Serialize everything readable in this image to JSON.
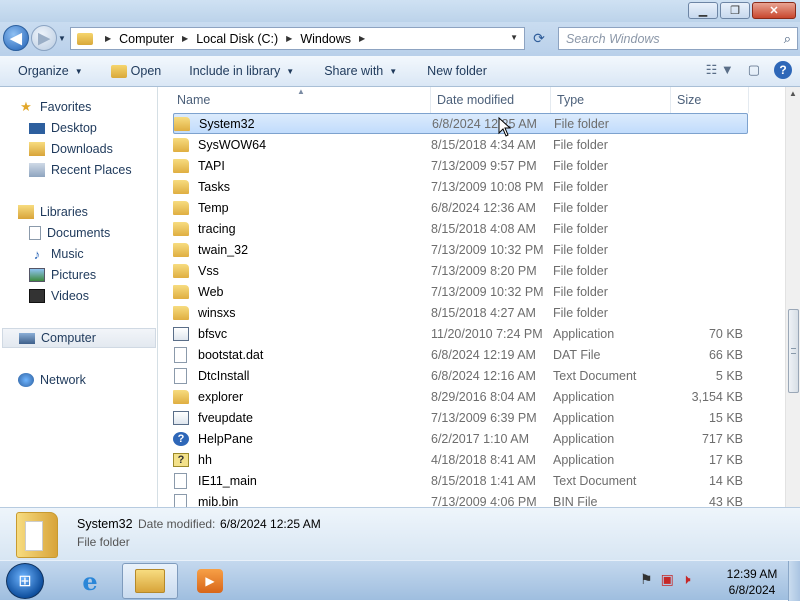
{
  "window": {
    "minimize": "▁",
    "maximize": "❐",
    "close": "✕"
  },
  "address": {
    "crumbs": [
      "Computer",
      "Local Disk (C:)",
      "Windows"
    ],
    "search_placeholder": "Search Windows"
  },
  "toolbar": {
    "organize": "Organize",
    "open": "Open",
    "include_in_library": "Include in library",
    "share_with": "Share with",
    "new_folder": "New folder"
  },
  "nav": {
    "favorites": "Favorites",
    "desktop": "Desktop",
    "downloads": "Downloads",
    "recent_places": "Recent Places",
    "libraries": "Libraries",
    "documents": "Documents",
    "music": "Music",
    "pictures": "Pictures",
    "videos": "Videos",
    "computer": "Computer",
    "network": "Network"
  },
  "columns": {
    "name": "Name",
    "date_modified": "Date modified",
    "type": "Type",
    "size": "Size"
  },
  "files": [
    {
      "name": "System32",
      "date": "6/8/2024 12:25 AM",
      "type": "File folder",
      "size": "",
      "icon": "folder"
    },
    {
      "name": "SysWOW64",
      "date": "8/15/2018 4:34 AM",
      "type": "File folder",
      "size": "",
      "icon": "folder"
    },
    {
      "name": "TAPI",
      "date": "7/13/2009 9:57 PM",
      "type": "File folder",
      "size": "",
      "icon": "folder"
    },
    {
      "name": "Tasks",
      "date": "7/13/2009 10:08 PM",
      "type": "File folder",
      "size": "",
      "icon": "folder"
    },
    {
      "name": "Temp",
      "date": "6/8/2024 12:36 AM",
      "type": "File folder",
      "size": "",
      "icon": "folder"
    },
    {
      "name": "tracing",
      "date": "8/15/2018 4:08 AM",
      "type": "File folder",
      "size": "",
      "icon": "folder"
    },
    {
      "name": "twain_32",
      "date": "7/13/2009 10:32 PM",
      "type": "File folder",
      "size": "",
      "icon": "folder"
    },
    {
      "name": "Vss",
      "date": "7/13/2009 8:20 PM",
      "type": "File folder",
      "size": "",
      "icon": "folder"
    },
    {
      "name": "Web",
      "date": "7/13/2009 10:32 PM",
      "type": "File folder",
      "size": "",
      "icon": "folder"
    },
    {
      "name": "winsxs",
      "date": "8/15/2018 4:27 AM",
      "type": "File folder",
      "size": "",
      "icon": "folder"
    },
    {
      "name": "bfsvc",
      "date": "11/20/2010 7:24 PM",
      "type": "Application",
      "size": "70 KB",
      "icon": "app"
    },
    {
      "name": "bootstat.dat",
      "date": "6/8/2024 12:19 AM",
      "type": "DAT File",
      "size": "66 KB",
      "icon": "file"
    },
    {
      "name": "DtcInstall",
      "date": "6/8/2024 12:16 AM",
      "type": "Text Document",
      "size": "5 KB",
      "icon": "file"
    },
    {
      "name": "explorer",
      "date": "8/29/2016 8:04 AM",
      "type": "Application",
      "size": "3,154 KB",
      "icon": "explorer"
    },
    {
      "name": "fveupdate",
      "date": "7/13/2009 6:39 PM",
      "type": "Application",
      "size": "15 KB",
      "icon": "app"
    },
    {
      "name": "HelpPane",
      "date": "6/2/2017 1:10 AM",
      "type": "Application",
      "size": "717 KB",
      "icon": "help"
    },
    {
      "name": "hh",
      "date": "4/18/2018 8:41 AM",
      "type": "Application",
      "size": "17 KB",
      "icon": "hh"
    },
    {
      "name": "IE11_main",
      "date": "8/15/2018 1:41 AM",
      "type": "Text Document",
      "size": "14 KB",
      "icon": "file"
    },
    {
      "name": "mib.bin",
      "date": "7/13/2009 4:06 PM",
      "type": "BIN File",
      "size": "43 KB",
      "icon": "file"
    }
  ],
  "details": {
    "name": "System32",
    "date_label": "Date modified:",
    "date_value": "6/8/2024 12:25 AM",
    "type": "File folder"
  },
  "taskbar": {
    "time": "12:39 AM",
    "date": "6/8/2024"
  },
  "colors": {
    "selection": "#cce4fc",
    "accent": "#1e395b"
  }
}
